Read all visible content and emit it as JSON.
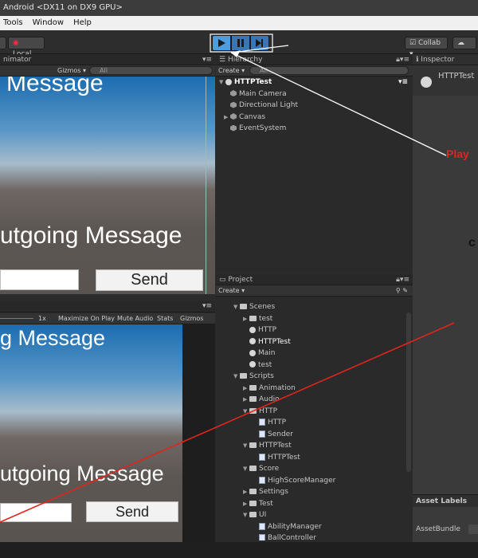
{
  "window": {
    "title": "Android <DX11 on DX9 GPU>"
  },
  "menu": [
    "Tools",
    "Window",
    "Help"
  ],
  "toolbar": {
    "local_label": "Local",
    "collab_label": "Collab",
    "collab_arrow": "▾"
  },
  "animator_tab": {
    "label": "nimator",
    "gizmos": "Gizmos ▾",
    "search_placeholder": "All"
  },
  "scene_view": {
    "message_text": "Message",
    "outgoing_text": "utgoing Message",
    "send_label": "Send"
  },
  "game_tab": {
    "scale": "1x",
    "maximize": "Maximize On Play",
    "mute": "Mute Audio",
    "stats": "Stats",
    "gizmos": "Gizmos"
  },
  "game_view": {
    "message_text": "g Message",
    "outgoing_text": "utgoing Message",
    "send_label": "Send"
  },
  "hierarchy": {
    "tab_label": "Hierarchy",
    "create_label": "Create ▾",
    "search_placeholder": "All",
    "scene_name": "HTTPTest",
    "items": [
      "Main Camera",
      "Directional Light",
      "Canvas",
      "EventSystem"
    ]
  },
  "project": {
    "tab_label": "Project",
    "create_label": "Create ▾",
    "rows": [
      {
        "label": "Scenes",
        "type": "folder",
        "depth": 0,
        "fold": "▼"
      },
      {
        "label": "test",
        "type": "folder",
        "depth": 1,
        "fold": "▶"
      },
      {
        "label": "HTTP",
        "type": "scene",
        "depth": 1,
        "fold": ""
      },
      {
        "label": "HTTPTest",
        "type": "scene",
        "depth": 1,
        "fold": "",
        "selected": true
      },
      {
        "label": "Main",
        "type": "scene",
        "depth": 1,
        "fold": ""
      },
      {
        "label": "test",
        "type": "scene",
        "depth": 1,
        "fold": ""
      },
      {
        "label": "Scripts",
        "type": "folder",
        "depth": 0,
        "fold": "▼"
      },
      {
        "label": "Animation",
        "type": "folder",
        "depth": 1,
        "fold": "▶"
      },
      {
        "label": "Audio",
        "type": "folder",
        "depth": 1,
        "fold": "▶"
      },
      {
        "label": "HTTP",
        "type": "folder",
        "depth": 1,
        "fold": "▼"
      },
      {
        "label": "HTTP",
        "type": "script",
        "depth": 2,
        "fold": ""
      },
      {
        "label": "Sender",
        "type": "script",
        "depth": 2,
        "fold": ""
      },
      {
        "label": "HTTPTest",
        "type": "folder",
        "depth": 1,
        "fold": "▼"
      },
      {
        "label": "HTTPTest",
        "type": "script",
        "depth": 2,
        "fold": ""
      },
      {
        "label": "Score",
        "type": "folder",
        "depth": 1,
        "fold": "▼"
      },
      {
        "label": "HighScoreManager",
        "type": "script",
        "depth": 2,
        "fold": ""
      },
      {
        "label": "Settings",
        "type": "folder",
        "depth": 1,
        "fold": "▶"
      },
      {
        "label": "Test",
        "type": "folder",
        "depth": 1,
        "fold": "▶"
      },
      {
        "label": "UI",
        "type": "folder",
        "depth": 1,
        "fold": "▼"
      },
      {
        "label": "AbilityManager",
        "type": "script",
        "depth": 2,
        "fold": ""
      },
      {
        "label": "BallController",
        "type": "script",
        "depth": 2,
        "fold": ""
      }
    ]
  },
  "inspector": {
    "tab_label": "Inspector",
    "object_name": "HTTPTest",
    "asset_labels": "Asset Labels",
    "asset_bundle": "AssetBundle"
  },
  "annotations": {
    "play_label": "Play",
    "c_label": "c"
  },
  "colors": {
    "play_blue": "#4a9de0",
    "annotation_red": "#e0241e",
    "panel": "#2b2b2b"
  }
}
